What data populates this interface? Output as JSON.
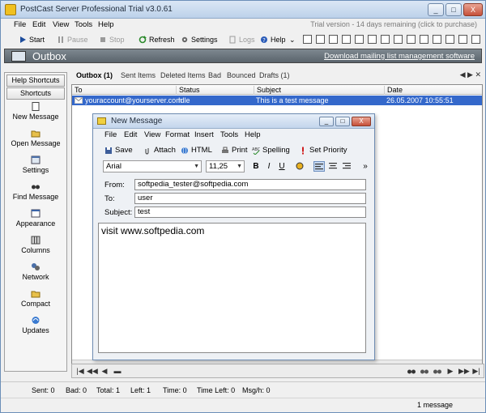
{
  "app": {
    "title": "PostCast Server Professional Trial v3.0.61",
    "trial_notice": "Trial version - 14 days remaining  (click to purchase)"
  },
  "window_controls": {
    "minimize": "_",
    "maximize": "□",
    "close": "X"
  },
  "menu": [
    "File",
    "Edit",
    "View",
    "Tools",
    "Help"
  ],
  "toolbar": {
    "start": "Start",
    "pause": "Pause",
    "stop": "Stop",
    "refresh": "Refresh",
    "settings": "Settings",
    "logs": "Logs",
    "help": "Help",
    "overflow": "⌄"
  },
  "outbox_header": {
    "title": "Outbox",
    "link": "Download mailing list management software"
  },
  "sidebar": {
    "tab_help": "Help Shortcuts",
    "tab_shortcuts": "Shortcuts",
    "items": [
      {
        "label": "New Message",
        "icon": "new-message-icon"
      },
      {
        "label": "Open Message",
        "icon": "open-message-icon"
      },
      {
        "label": "Settings",
        "icon": "settings-icon"
      },
      {
        "label": "Find Message",
        "icon": "find-message-icon"
      },
      {
        "label": "Appearance",
        "icon": "appearance-icon"
      },
      {
        "label": "Columns",
        "icon": "columns-icon"
      },
      {
        "label": "Network",
        "icon": "network-icon"
      },
      {
        "label": "Compact",
        "icon": "compact-icon"
      },
      {
        "label": "Updates",
        "icon": "updates-icon"
      }
    ]
  },
  "tabs": [
    {
      "label": "Outbox (1)",
      "active": true
    },
    {
      "label": "Sent Items"
    },
    {
      "label": "Deleted Items"
    },
    {
      "label": "Bad"
    },
    {
      "label": "Bounced"
    },
    {
      "label": "Drafts (1)"
    }
  ],
  "tab_nav": "◀ ▶ ✕",
  "grid": {
    "columns": [
      "To",
      "Status",
      "Subject",
      "Date"
    ],
    "rows": [
      {
        "to": "youraccount@yourserver.com",
        "status": "Idle",
        "subject": "This is a test message",
        "date": "26.05.2007 10:55:51"
      }
    ]
  },
  "navbar": {
    "left": [
      "|◀",
      "◀◀",
      "◀",
      "▬"
    ],
    "right": [
      "▶",
      "▶▶",
      "▶|"
    ]
  },
  "status": {
    "sent": "Sent: 0",
    "bad": "Bad: 0",
    "total": "Total: 1",
    "left": "Left: 1",
    "time": "Time: 0",
    "time_left": "Time Left: 0",
    "msgh": "Msg/h: 0",
    "message_count": "1 message"
  },
  "new_message": {
    "title": "New Message",
    "menu": [
      "File",
      "Edit",
      "View",
      "Format",
      "Insert",
      "Tools",
      "Help"
    ],
    "toolbar": {
      "save": "Save",
      "attach": "Attach",
      "html": "HTML",
      "print": "Print",
      "spelling": "Spelling",
      "priority": "Set Priority"
    },
    "font": "Arial",
    "size": "11,25",
    "format_buttons": {
      "bold": "B",
      "italic": "I",
      "underline": "U"
    },
    "from_label": "From:",
    "from_value": "softpedia_tester@softpedia.com",
    "to_label": "To:",
    "to_value": "user",
    "subject_label": "Subject:",
    "subject_value": "test",
    "body": "visit www.softpedia.com"
  }
}
